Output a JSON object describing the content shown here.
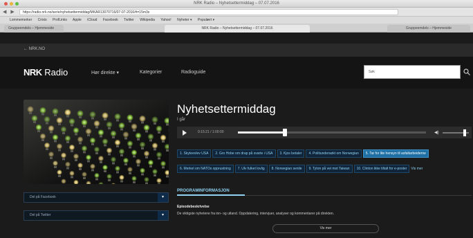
{
  "browser": {
    "window_title": "NRK Radio – Nyhetsettermiddag – 07.07.2016",
    "url": "https://radio.nrk.no/serie/nyhetsettermiddag/MKAR13070716/07-07-2016#t=15m3s",
    "bookmarks": [
      "Lommemerker",
      "Cristo",
      "ProfLinks",
      "Apple",
      "iCloud",
      "Facebook",
      "Twitter",
      "Wikipedia",
      "Yahoo!",
      "Nyheter ▾",
      "Populært ▾"
    ],
    "tabs": [
      "Gruppeemdels – Hjemmeside",
      "NRK Radio – Nyhetsettermiddag – 07.07.2016",
      "Gruppeemdels – Hjemmeside"
    ]
  },
  "back_link": "← NRK.NO",
  "header": {
    "logo_mark": "NRK",
    "logo_text": "Radio",
    "nav": [
      "Hør direkte ▾",
      "Kategorier",
      "Radioguide"
    ],
    "search_value": "Søk"
  },
  "program": {
    "title": "Nyhetsettermiddag",
    "subtitle": "I går",
    "time": "0:15:21 / 1:00:00",
    "progress": 0.25,
    "volume": 0.85
  },
  "chapters": [
    {
      "label": "1. Skyteevlev USA",
      "active": false
    },
    {
      "label": "2. Gro Hobe om drap på svarte i USA",
      "active": false
    },
    {
      "label": "3. Kjos betaler",
      "active": false
    },
    {
      "label": "4. Politiundersøkt om Norwegian",
      "active": false
    },
    {
      "label": "5. Tar for lite hensyn til asfaltarbeiderne",
      "active": true
    },
    {
      "label": "6. Merkel om NATOs opprustning",
      "active": false
    },
    {
      "label": "7. Ulv fulket lovlig",
      "active": false
    },
    {
      "label": "8. Norwegian senile",
      "active": false
    },
    {
      "label": "9. Tyton på vei mot Taiwan",
      "active": false
    },
    {
      "label": "10. Clinton ikke tiltalt for e-poster",
      "active": false
    }
  ],
  "chapters_more": "Vis mer",
  "share": [
    "Del på Facebook",
    "Del på Twitter"
  ],
  "info": {
    "tab": "PROGRAMINFORMASJON",
    "heading": "Episodebeskrivelse",
    "text": "De viktigste nyhetene fra inn- og utland. Oppdatering, intervjuer, analyser og kommentarer på direkten.",
    "more_button": "Vis mer"
  },
  "colors": {
    "accent": "#8fd2f4",
    "active_chapter": "#1e6fa3",
    "background": "#1b1b1b"
  }
}
